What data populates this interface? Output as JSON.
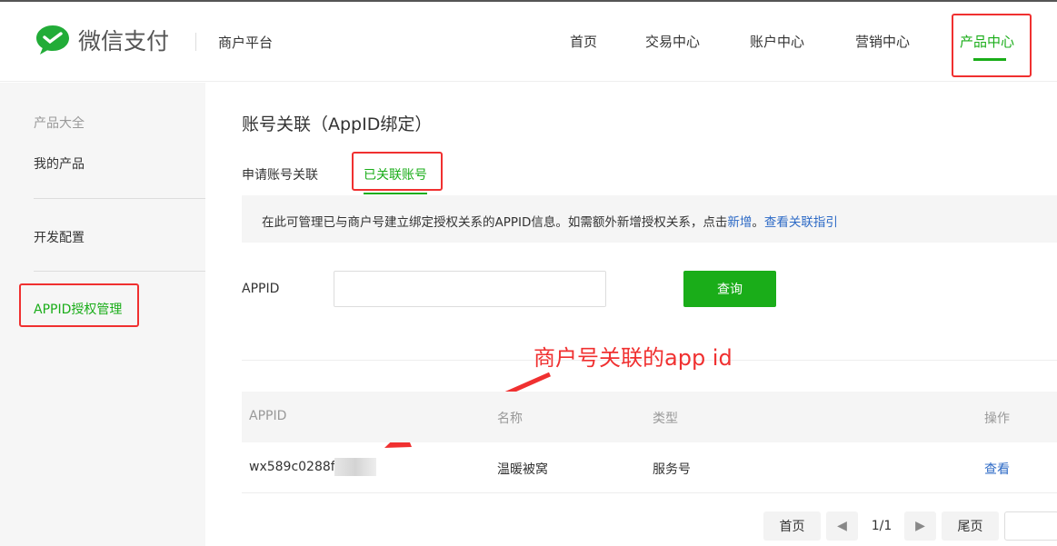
{
  "header": {
    "brand": "微信支付",
    "platform": "商户平台",
    "nav": [
      "首页",
      "交易中心",
      "账户中心",
      "营销中心",
      "产品中心"
    ],
    "active_nav": "产品中心",
    "accent": "#1aad19"
  },
  "sidebar": {
    "items": [
      "产品大全",
      "我的产品",
      "开发配置",
      "APPID授权管理"
    ],
    "active": "APPID授权管理"
  },
  "main": {
    "title": "账号关联（AppID绑定）",
    "tabs": [
      "申请账号关联",
      "已关联账号"
    ],
    "active_tab": "已关联账号",
    "notice": {
      "text": "在此可管理已与商户号建立绑定授权关系的APPID信息。如需额外新增授权关系，点击",
      "link1": "新增",
      "sep": "。",
      "link2": "查看关联指引"
    },
    "search": {
      "label": "APPID",
      "value": "",
      "button": "查询"
    },
    "annotation": "商户号关联的app id",
    "table": {
      "headers": [
        "APPID",
        "名称",
        "类型",
        "操作"
      ],
      "rows": [
        {
          "appid": "wx589c0288fc0",
          "name": "温暖被窝",
          "type": "服务号",
          "action": "查看"
        }
      ]
    },
    "pagination": {
      "first": "首页",
      "page": "1/1",
      "last": "尾页"
    }
  },
  "annotation_color": "#f03030"
}
